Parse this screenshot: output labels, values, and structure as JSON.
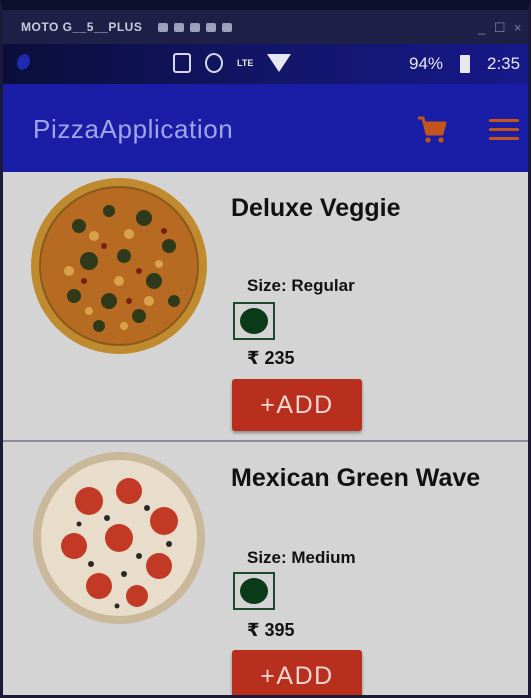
{
  "chrome": {
    "device": "MOTO G__5__PLUS",
    "controls": [
      "_",
      "☐",
      "×"
    ]
  },
  "status_bar": {
    "network": "LTE",
    "battery": "94%",
    "time": "2:35"
  },
  "app_bar": {
    "title": "PizzaApplication",
    "icons": [
      "cart-icon",
      "menu-icon"
    ],
    "accent_color": "#c2541e",
    "background_color": "#1a1ea6"
  },
  "pizzas": [
    {
      "name": "Deluxe Veggie",
      "size": "Size: Regular",
      "price": "₹ 235",
      "add_label": "+ADD"
    },
    {
      "name": "Mexican Green Wave",
      "size": "Size: Medium",
      "price": "₹ 395",
      "add_label": "+ADD"
    }
  ],
  "colors": {
    "add_button": "#b8301d",
    "veg_badge": "#0b3a18"
  }
}
